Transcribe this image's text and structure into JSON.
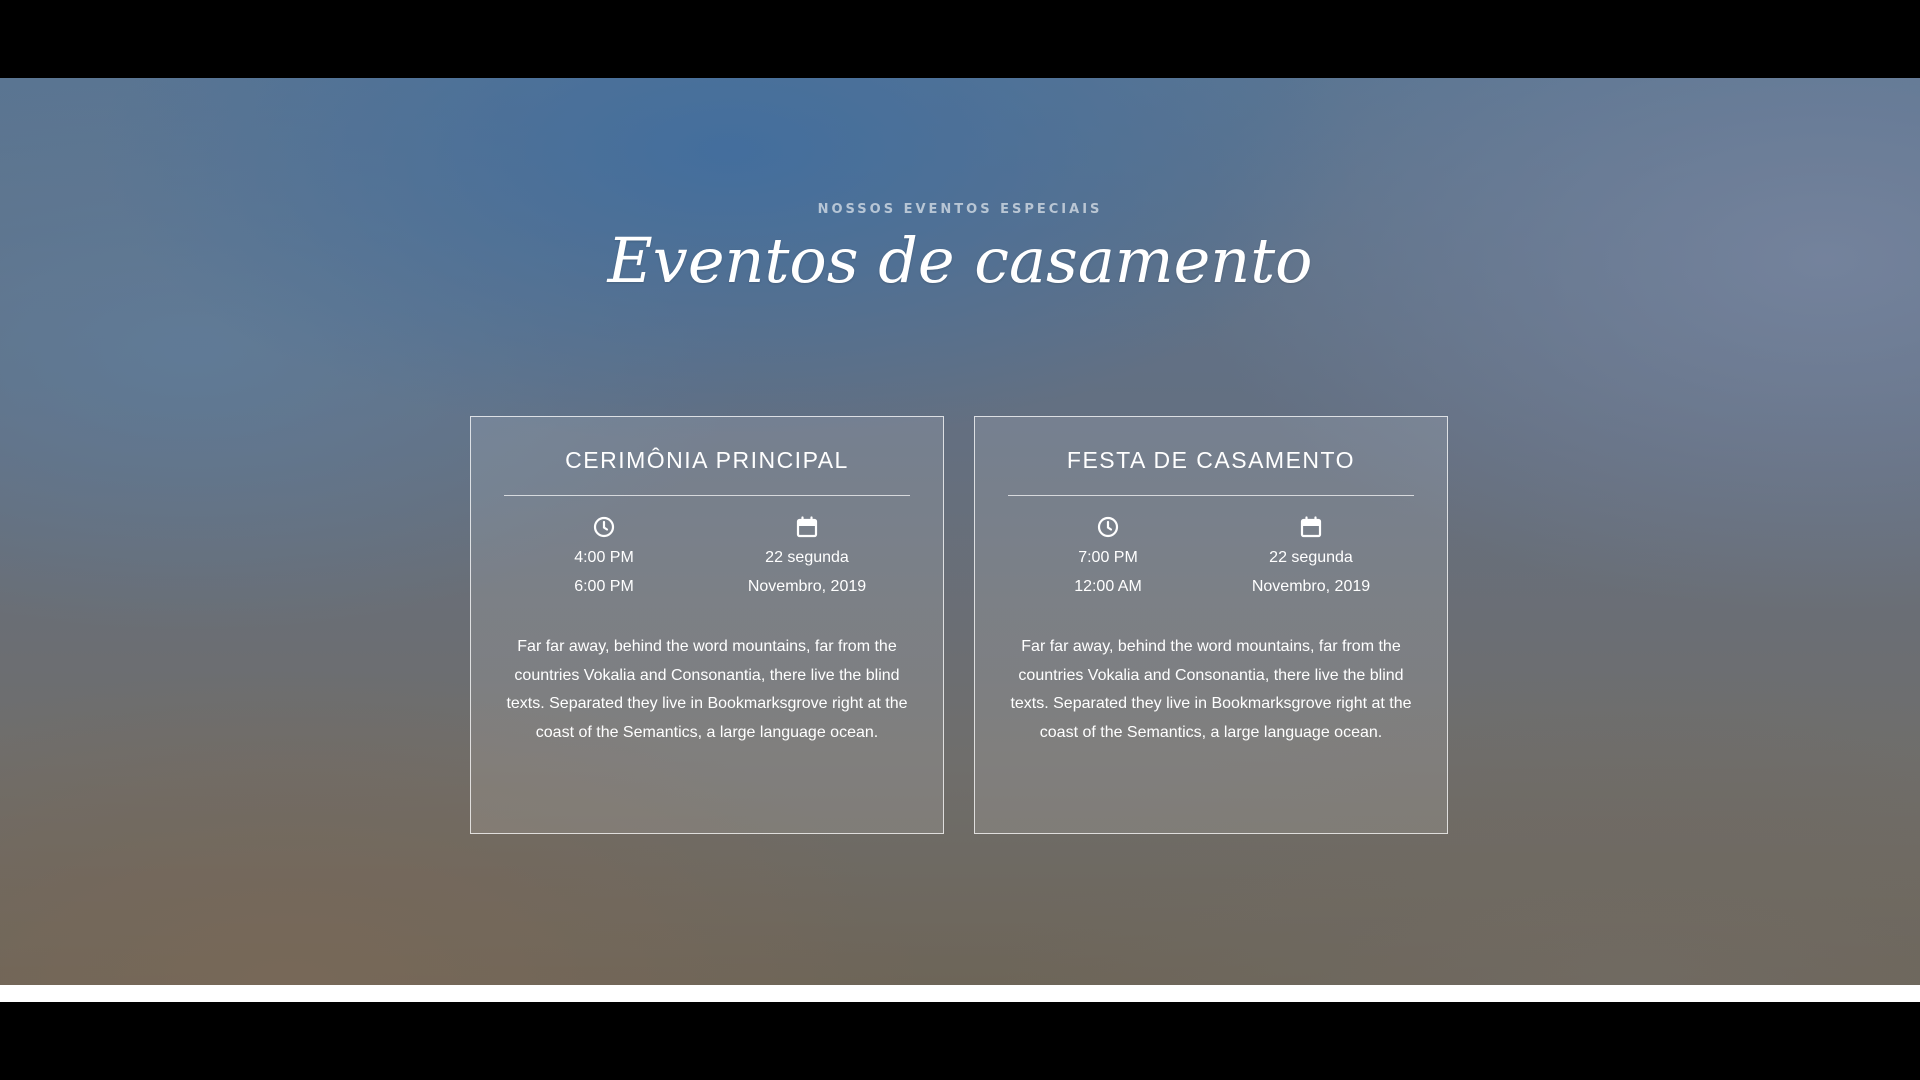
{
  "section": {
    "eyebrow": "NOSSOS EVENTOS ESPECIAIS",
    "heading": "Eventos de casamento"
  },
  "events": [
    {
      "title": "CERIMÔNIA PRINCIPAL",
      "time_icon": "clock-icon",
      "time_start": "4:00 PM",
      "time_end": "6:00 PM",
      "date_icon": "calendar-icon",
      "date_day": "22 segunda",
      "date_month_year": "Novembro, 2019",
      "description": "Far far away, behind the word mountains, far from the countries Vokalia and Consonantia, there live the blind texts. Separated they live in Bookmarksgrove right at the coast of the Semantics, a large language ocean."
    },
    {
      "title": "FESTA DE CASAMENTO",
      "time_icon": "clock-icon",
      "time_start": "7:00 PM",
      "time_end": "12:00 AM",
      "date_icon": "calendar-icon",
      "date_day": "22 segunda",
      "date_month_year": "Novembro, 2019",
      "description": "Far far away, behind the word mountains, far from the countries Vokalia and Consonantia, there live the blind texts. Separated they live in Bookmarksgrove right at the coast of the Semantics, a large language ocean."
    }
  ],
  "back_to_top": {
    "icon": "arrow-up-icon"
  },
  "colors": {
    "background_top": "#4a6f96",
    "background_bottom": "#6d6558",
    "text": "#ffffff",
    "button": "#1d1d1d"
  }
}
